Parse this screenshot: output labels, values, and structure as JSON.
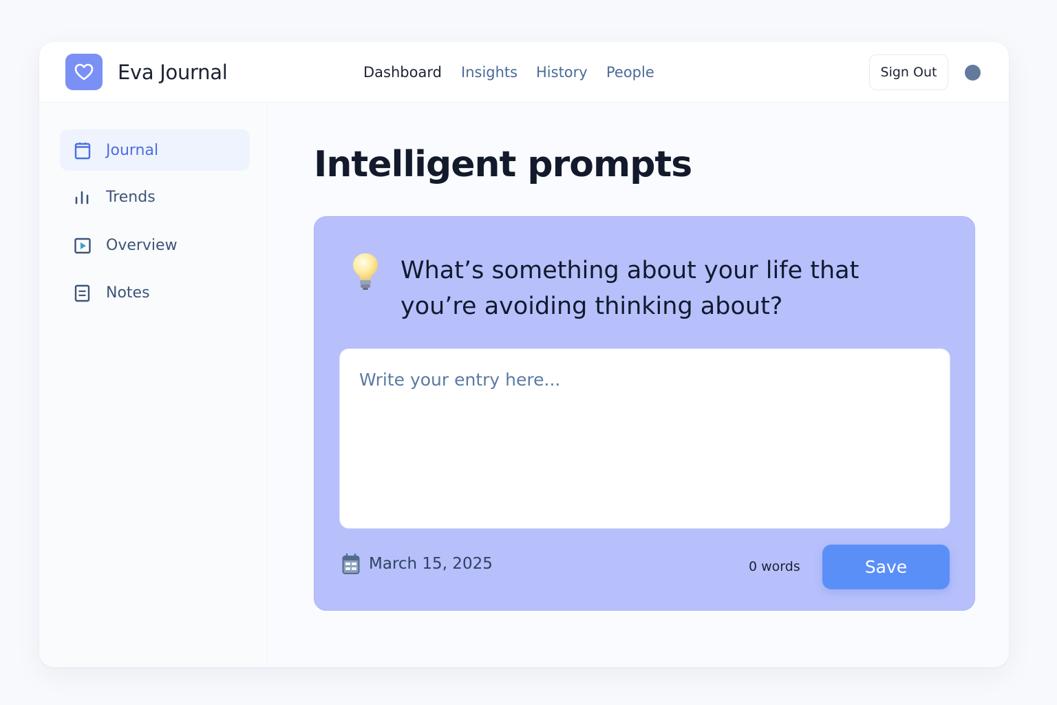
{
  "app": {
    "title": "Eva Journal",
    "logo_icon": "heart-icon",
    "accent": "#7b90f5"
  },
  "topnav": {
    "items": [
      {
        "label": "Dashboard",
        "active": true
      },
      {
        "label": "Insights",
        "active": false
      },
      {
        "label": "History",
        "active": false
      },
      {
        "label": "People",
        "active": false
      }
    ],
    "sign_out_label": "Sign Out"
  },
  "sidebar": {
    "items": [
      {
        "label": "Journal",
        "icon": "journal-icon",
        "active": true
      },
      {
        "label": "Trends",
        "icon": "bar-chart-icon",
        "active": false
      },
      {
        "label": "Overview",
        "icon": "play-square-icon",
        "active": false
      },
      {
        "label": "Notes",
        "icon": "note-icon",
        "active": false
      }
    ]
  },
  "main": {
    "title": "Intelligent prompts",
    "prompt_card": {
      "icon": "lightbulb-icon",
      "prompt": "What’s something about your life that you’re avoiding thinking about?",
      "entry_value": "",
      "entry_placeholder": "Write your entry here...",
      "date_icon": "calendar-icon",
      "date": "March 15, 2025",
      "word_count": "0 words",
      "save_label": "Save",
      "card_color": "#b7c0fb",
      "save_color": "#5b8ff8"
    }
  }
}
